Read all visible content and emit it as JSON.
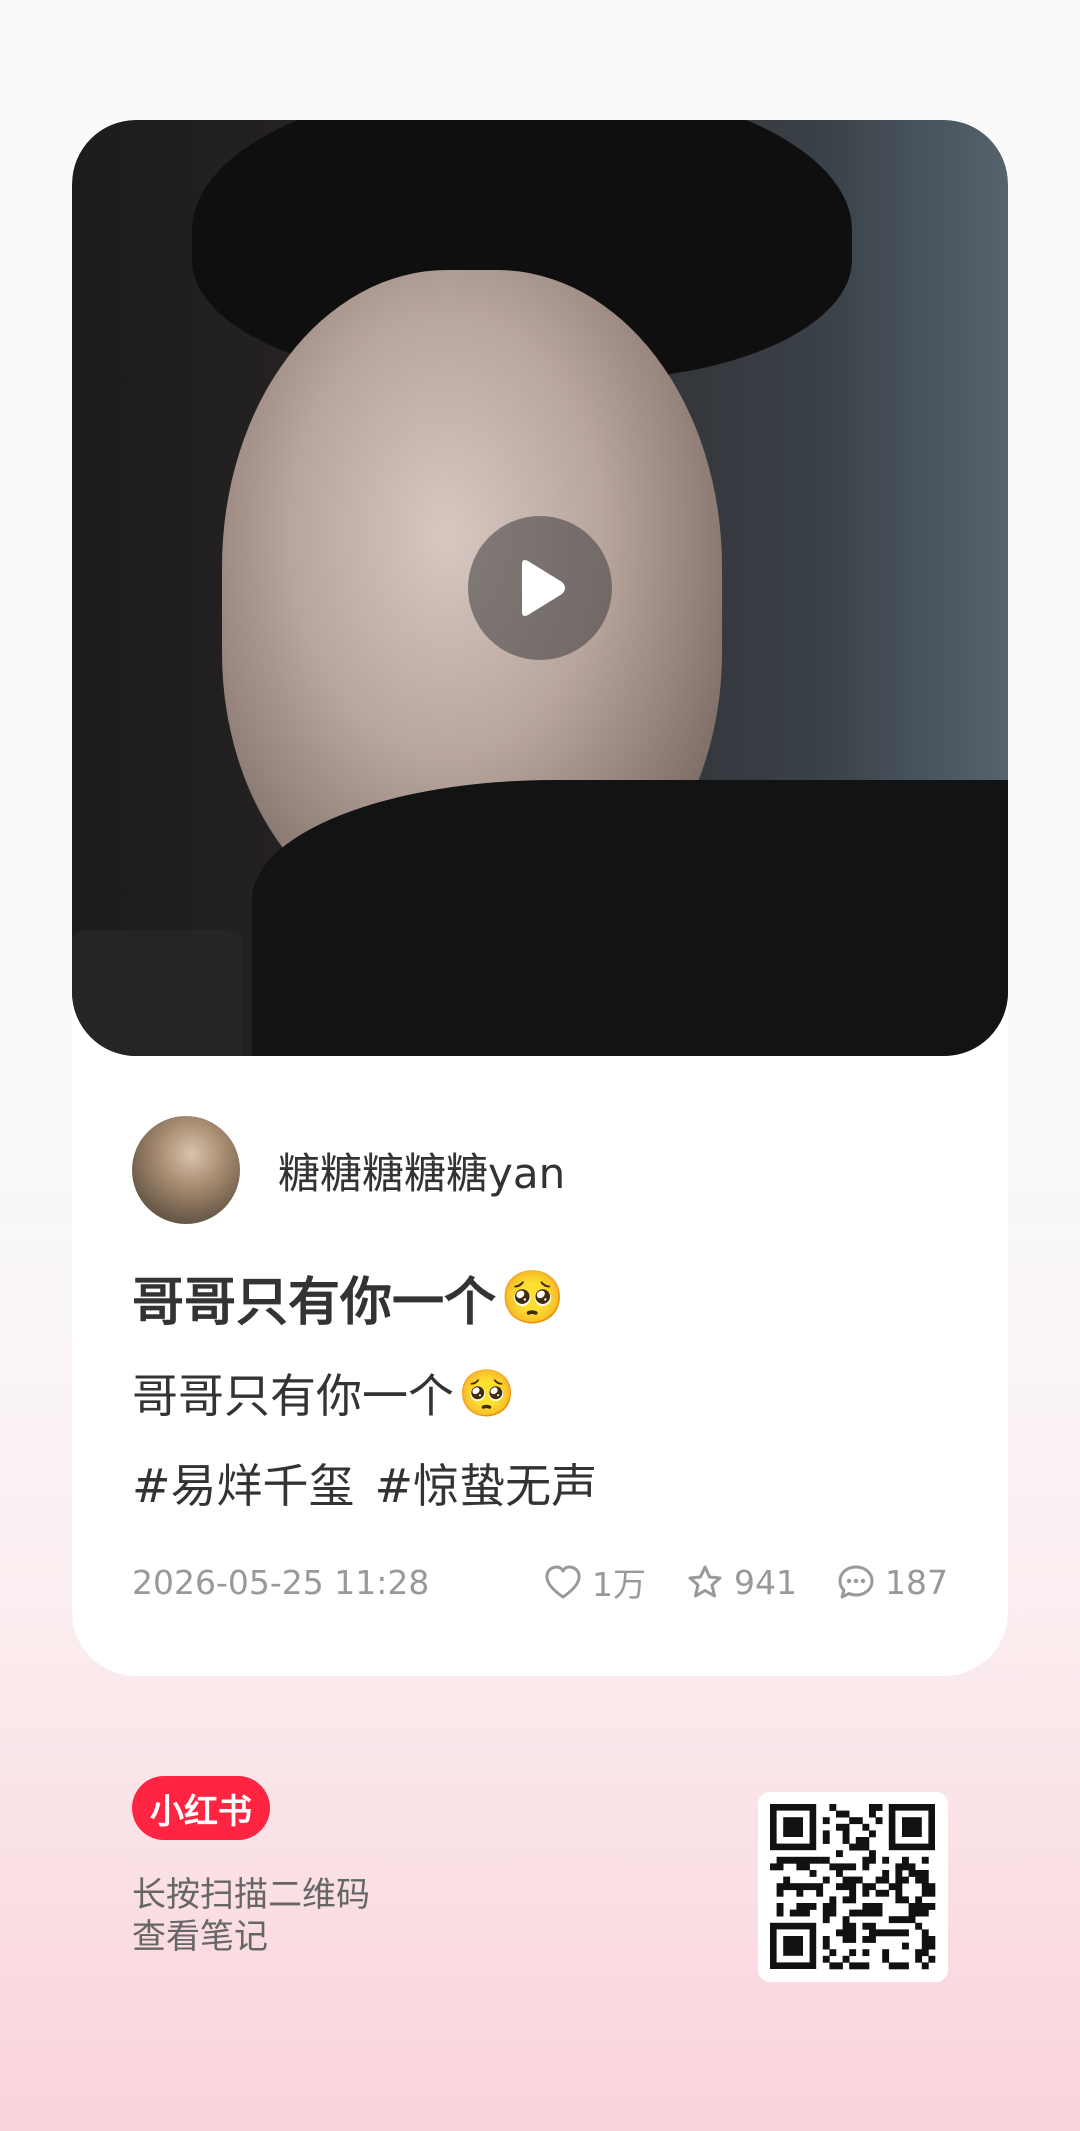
{
  "post": {
    "author": "糖糖糖糖糖yan",
    "title": "哥哥只有你一个",
    "description": "哥哥只有你一个",
    "emoji": "🥺",
    "tags": [
      "#易烊千玺",
      "#惊蛰无声"
    ],
    "date": "2026-05-25 11:28",
    "likes": "1万",
    "favorites": "941",
    "comments": "187"
  },
  "footer": {
    "logo_text": "小红书",
    "scan_line1": "长按扫描二维码",
    "scan_line2": "查看笔记"
  },
  "colors": {
    "brand": "#ff2442",
    "text_primary": "#333333",
    "text_secondary": "#999999"
  },
  "icons": [
    "play-icon",
    "heart-icon",
    "star-icon",
    "comment-icon",
    "qr-code"
  ]
}
